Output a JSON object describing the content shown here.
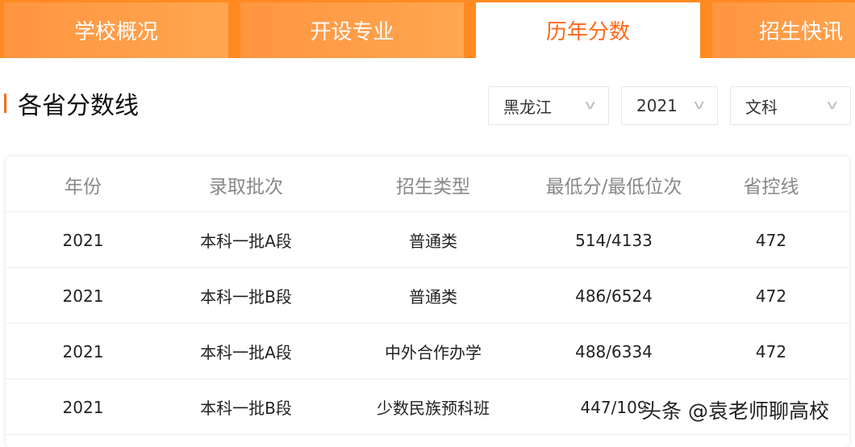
{
  "tabs": [
    "学校概况",
    "开设专业",
    "历年分数",
    "招生快讯"
  ],
  "section_title": "各省分数线",
  "filters": {
    "province": "黑龙江",
    "year": "2021",
    "subject": "文科"
  },
  "table": {
    "headers": [
      "年份",
      "录取批次",
      "招生类型",
      "最低分/最低位次",
      "省控线"
    ],
    "rows": [
      [
        "2021",
        "本科一批A段",
        "普通类",
        "514/4133",
        "472"
      ],
      [
        "2021",
        "本科一批B段",
        "普通类",
        "486/6524",
        "472"
      ],
      [
        "2021",
        "本科一批A段",
        "中外合作办学",
        "488/6334",
        "472"
      ],
      [
        "2021",
        "本科一批B段",
        "少数民族预科班",
        "447/109",
        ""
      ]
    ]
  },
  "watermark": "头条 @袁老师聊高校"
}
